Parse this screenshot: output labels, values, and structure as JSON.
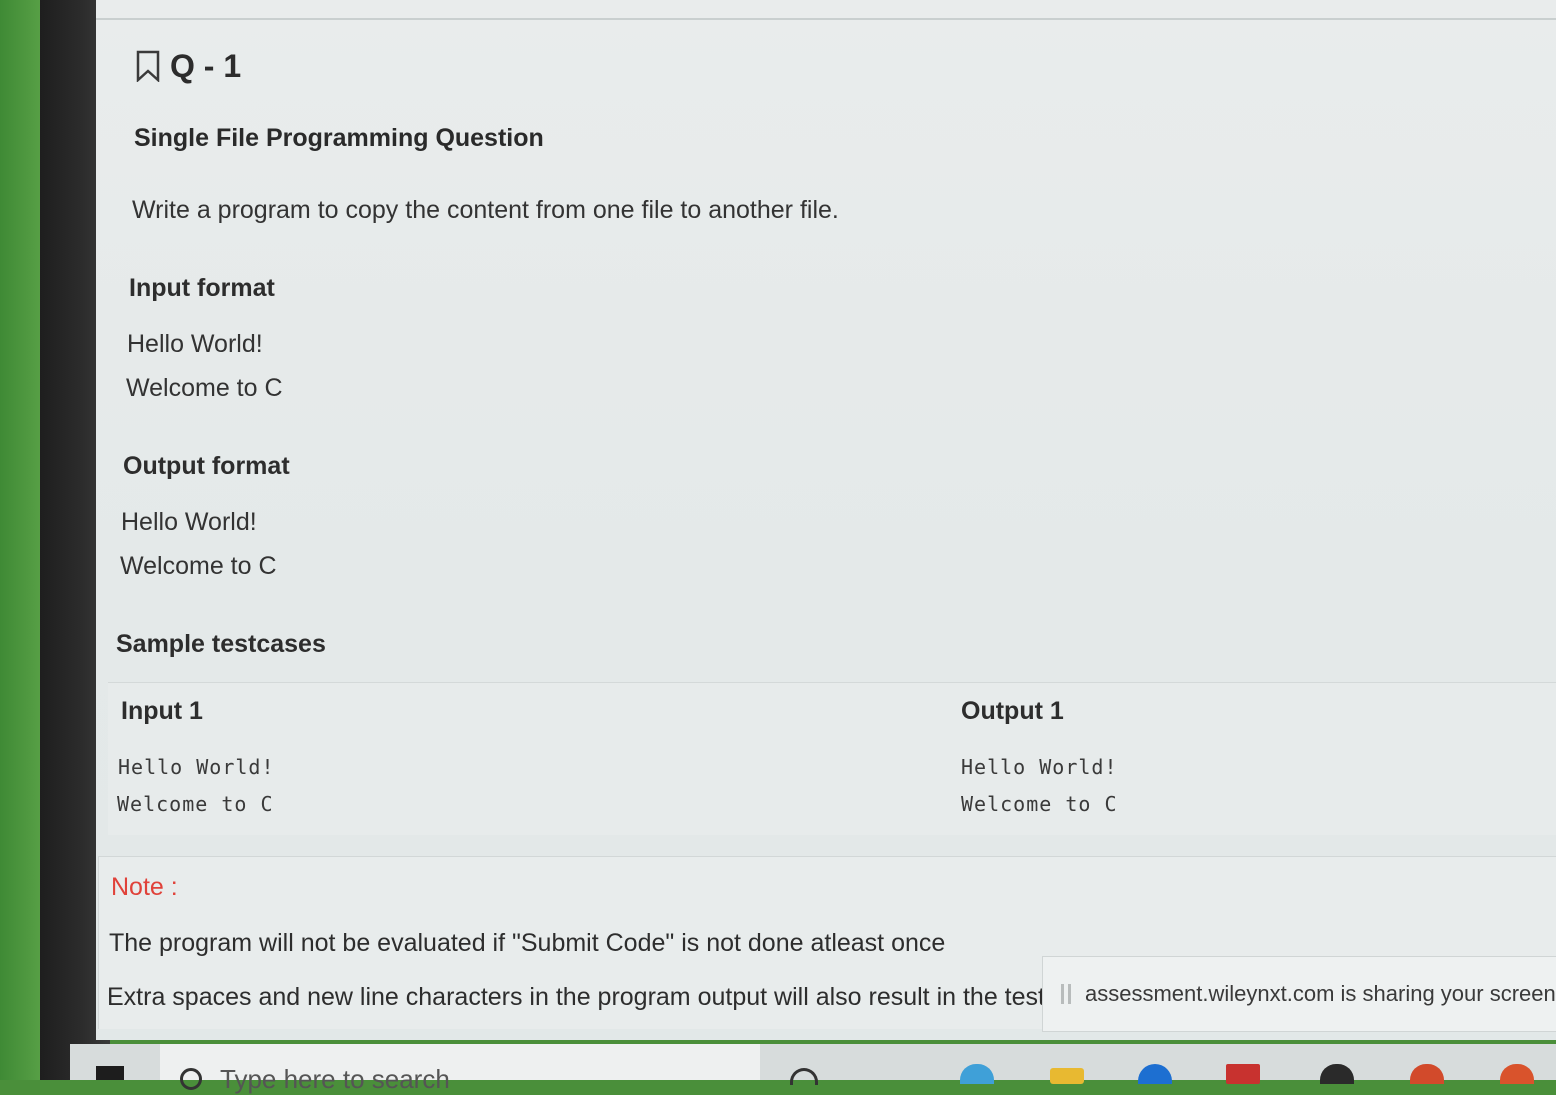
{
  "question": {
    "number": "Q - 1",
    "type": "Single File Programming Question",
    "prompt": "Write a program to copy the content from one file to another file."
  },
  "input_format": {
    "title": "Input format",
    "lines": [
      "Hello World!",
      "Welcome to C"
    ]
  },
  "output_format": {
    "title": "Output format",
    "lines": [
      "Hello World!",
      "Welcome to C"
    ]
  },
  "sample_testcases": {
    "title": "Sample testcases",
    "input": {
      "title": "Input 1",
      "lines": [
        "Hello World!",
        "Welcome to C"
      ]
    },
    "output": {
      "title": "Output 1",
      "lines": [
        "Hello World!",
        "Welcome to C"
      ]
    }
  },
  "note": {
    "title": "Note :",
    "lines": [
      "The program will not be evaluated if \"Submit Code\" is not done atleast once",
      "Extra spaces and new line characters in the program output will also result in the testc"
    ]
  },
  "screen_share": {
    "message": "assessment.wileynxt.com is sharing your screen."
  },
  "taskbar": {
    "search_placeholder": "Type here to search"
  },
  "colors": {
    "note_title": "#e0423a",
    "screen_bg": "#e6eaea",
    "desk_green": "#4a8f3a"
  },
  "icons": [
    "bookmark-icon",
    "pause-icon",
    "windows-start-icon",
    "search-icon"
  ]
}
